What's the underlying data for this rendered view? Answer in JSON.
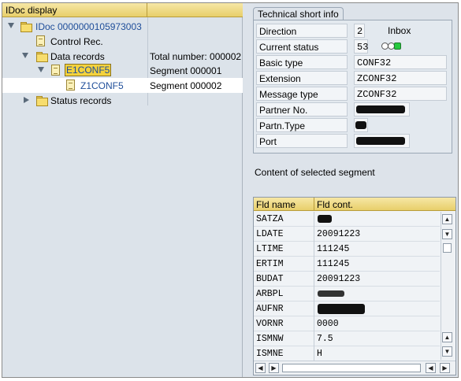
{
  "left": {
    "header": {
      "title": "IDoc display",
      "col2": ""
    },
    "tree": {
      "idoc": "IDoc 0000000105973003",
      "control": "Control Rec.",
      "data": "Data records",
      "data_total": "Total number: 000002",
      "seg1": "E1CONF5",
      "seg1_val": "Segment 000001",
      "seg2": "Z1CONF5",
      "seg2_val": "Segment 000002",
      "status": "Status records"
    }
  },
  "right": {
    "group_title": "Technical short info",
    "fields": {
      "direction": {
        "label": "Direction",
        "value": "2",
        "extra": "Inbox"
      },
      "status": {
        "label": "Current status",
        "value": "53"
      },
      "basic": {
        "label": "Basic type",
        "value": "CONF32"
      },
      "extension": {
        "label": "Extension",
        "value": "ZCONF32"
      },
      "msgtype": {
        "label": "Message type",
        "value": "ZCONF32"
      },
      "partner": {
        "label": "Partner No."
      },
      "partntype": {
        "label": "Partn.Type"
      },
      "port": {
        "label": "Port"
      }
    },
    "segment_caption": "Content of selected segment",
    "table": {
      "headers": [
        "Fld name",
        "Fld cont."
      ],
      "rows": [
        {
          "name": "SATZA",
          "value": ""
        },
        {
          "name": "LDATE",
          "value": "20091223"
        },
        {
          "name": "LTIME",
          "value": "111245"
        },
        {
          "name": "ERTIM",
          "value": "111245"
        },
        {
          "name": "BUDAT",
          "value": "20091223"
        },
        {
          "name": "ARBPL",
          "value": ""
        },
        {
          "name": "AUFNR",
          "value": ""
        },
        {
          "name": "VORNR",
          "value": "0000"
        },
        {
          "name": "ISMNW",
          "value": "7.5"
        },
        {
          "name": "ISMNE",
          "value": "H"
        }
      ]
    }
  },
  "colors": {
    "header": "#e8cf6a",
    "selection": "#f4d23c",
    "link": "#1f4e9a",
    "status_green": "#27c93f"
  },
  "icons": [
    "folder-icon",
    "document-icon",
    "expand-triangle-icon",
    "traffic-light-icon",
    "scroll-arrow-icon"
  ]
}
